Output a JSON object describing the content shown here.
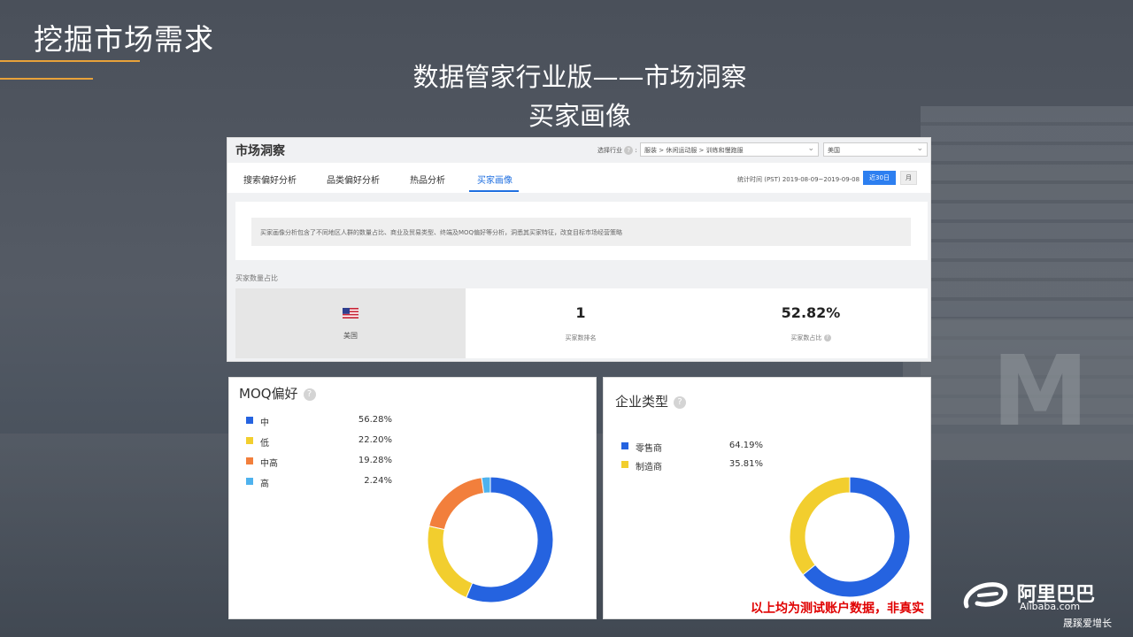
{
  "slide": {
    "title": "挖掘市场需求",
    "subtitle_line1": "数据管家行业版——市场洞察",
    "subtitle_line2": "买家画像",
    "disclaimer": "以上均为测试账户数据，非真实",
    "footer": "晟蹊爱增长",
    "logo_cn": "阿里巴巴",
    "logo_en": "Alibaba.com",
    "accent_color": "#e8a23a"
  },
  "market": {
    "title": "市场洞察",
    "select_label": "选择行业",
    "industry_value": "服装 > 休闲运动服 > 训练和慢跑服",
    "country_value": "美国",
    "tabs": [
      {
        "label": "搜索偏好分析",
        "active": false
      },
      {
        "label": "品类偏好分析",
        "active": false
      },
      {
        "label": "热品分析",
        "active": false
      },
      {
        "label": "买家画像",
        "active": true
      }
    ],
    "stat_time": "统计时间 (PST) 2019-08-09~2019-09-08",
    "btn_30days": "近30日",
    "btn_month": "月",
    "description": "买家画像分析包含了不同地区人群的数量占比、商业及贸易类型、终端及MOQ偏好等分析，洞悉其买家特征，改变目标市场经营策略",
    "section_label": "买家数量占比",
    "country": "美国",
    "rank_value": "1",
    "rank_label": "买家数排名",
    "share_value": "52.82%",
    "share_label": "买家数占比"
  },
  "moq": {
    "title": "MOQ偏好",
    "help": "?"
  },
  "enterprise": {
    "title": "企业类型",
    "help": "?"
  },
  "chart_data": [
    {
      "type": "pie",
      "title": "MOQ偏好",
      "categories": [
        "中",
        "低",
        "中高",
        "高"
      ],
      "values": [
        56.28,
        22.2,
        19.28,
        2.24
      ],
      "labels": [
        "56.28%",
        "22.20%",
        "19.28%",
        "2.24%"
      ],
      "colors": [
        "#2563e0",
        "#f2ce2e",
        "#f27f3c",
        "#4eb2ee"
      ],
      "legend": "top-left"
    },
    {
      "type": "pie",
      "title": "企业类型",
      "categories": [
        "零售商",
        "制造商"
      ],
      "values": [
        64.19,
        35.81
      ],
      "labels": [
        "64.19%",
        "35.81%"
      ],
      "colors": [
        "#2563e0",
        "#f2ce2e"
      ],
      "legend": "top-left"
    }
  ]
}
